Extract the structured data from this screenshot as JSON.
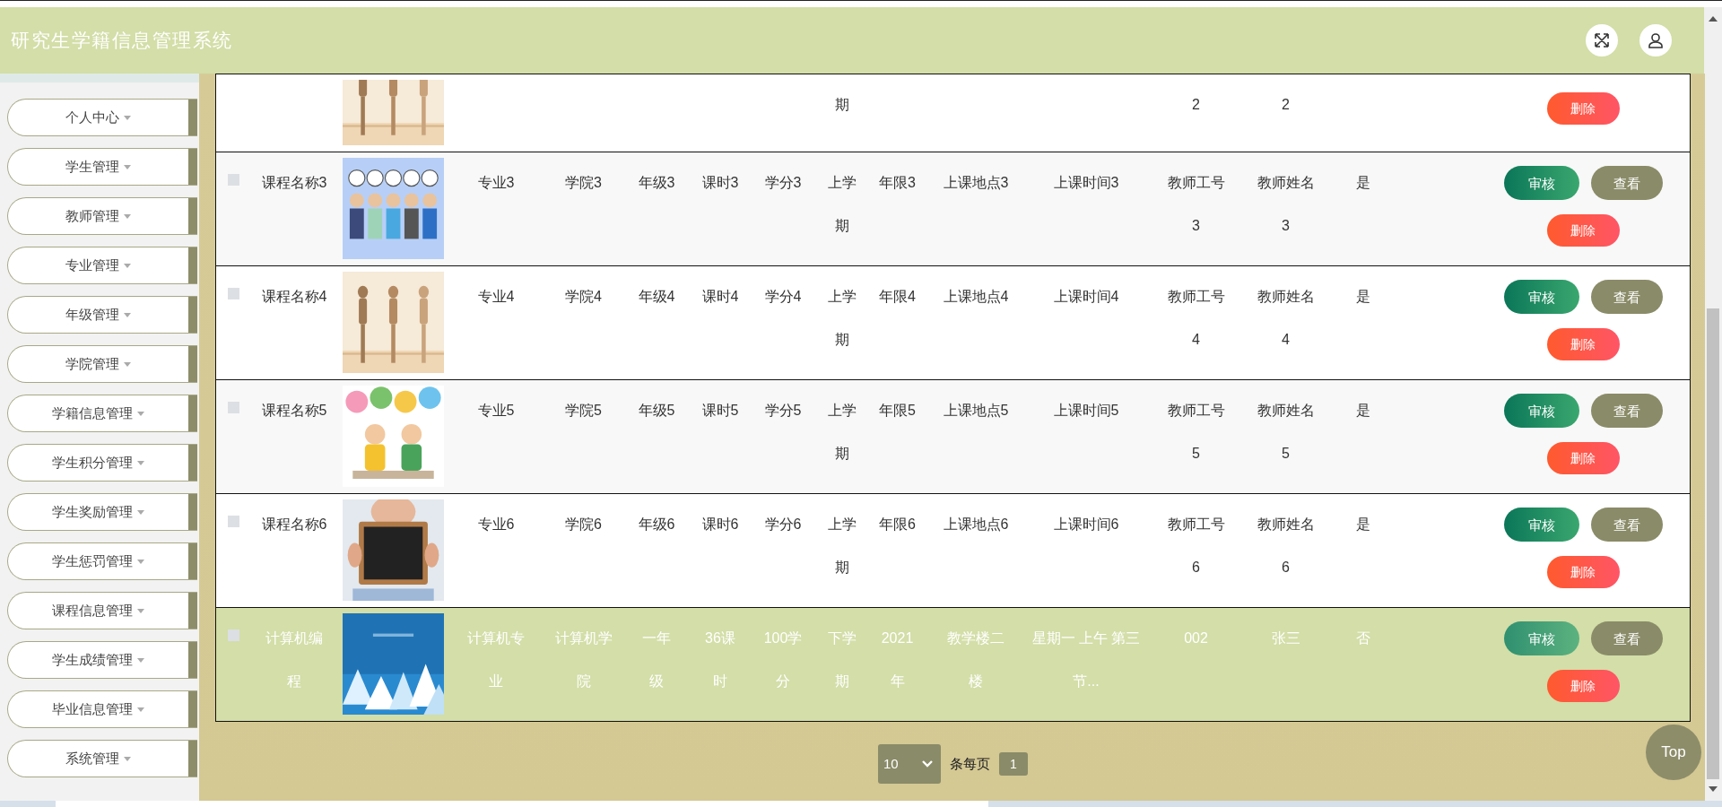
{
  "header": {
    "title": "研究生学籍信息管理系统"
  },
  "sidebar": {
    "items": [
      {
        "label": "个人中心"
      },
      {
        "label": "学生管理"
      },
      {
        "label": "教师管理"
      },
      {
        "label": "专业管理"
      },
      {
        "label": "年级管理"
      },
      {
        "label": "学院管理"
      },
      {
        "label": "学籍信息管理"
      },
      {
        "label": "学生积分管理"
      },
      {
        "label": "学生奖励管理"
      },
      {
        "label": "学生惩罚管理"
      },
      {
        "label": "课程信息管理"
      },
      {
        "label": "学生成绩管理"
      },
      {
        "label": "毕业信息管理"
      },
      {
        "label": "系统管理"
      }
    ]
  },
  "table": {
    "rows": [
      {
        "kind": "partial",
        "selected": false,
        "term": "期",
        "teacher_id": "2",
        "teacher_name": "2",
        "actions": [
          {
            "kind": "delete",
            "label": "删除"
          }
        ]
      },
      {
        "kind": "full",
        "selected": false,
        "checked": false,
        "name": "课程名称3",
        "major": "专业3",
        "college": "学院3",
        "grade": "年级3",
        "hours": "课时3",
        "credits": "学分3",
        "term": "上学期",
        "years": "年限3",
        "location": "上课地点3",
        "time": "上课时间3",
        "teacher_id": "教师工号3",
        "teacher_name": "教师姓名3",
        "approved": "是",
        "actions": [
          {
            "kind": "approve",
            "label": "审核"
          },
          {
            "kind": "view",
            "label": "查看"
          },
          {
            "kind": "delete",
            "label": "删除"
          }
        ]
      },
      {
        "kind": "full",
        "selected": false,
        "checked": false,
        "name": "课程名称4",
        "major": "专业4",
        "college": "学院4",
        "grade": "年级4",
        "hours": "课时4",
        "credits": "学分4",
        "term": "上学期",
        "years": "年限4",
        "location": "上课地点4",
        "time": "上课时间4",
        "teacher_id": "教师工号4",
        "teacher_name": "教师姓名4",
        "approved": "是",
        "actions": [
          {
            "kind": "approve",
            "label": "审核"
          },
          {
            "kind": "view",
            "label": "查看"
          },
          {
            "kind": "delete",
            "label": "删除"
          }
        ]
      },
      {
        "kind": "full",
        "selected": false,
        "checked": false,
        "name": "课程名称5",
        "major": "专业5",
        "college": "学院5",
        "grade": "年级5",
        "hours": "课时5",
        "credits": "学分5",
        "term": "上学期",
        "years": "年限5",
        "location": "上课地点5",
        "time": "上课时间5",
        "teacher_id": "教师工号5",
        "teacher_name": "教师姓名5",
        "approved": "是",
        "actions": [
          {
            "kind": "approve",
            "label": "审核"
          },
          {
            "kind": "view",
            "label": "查看"
          },
          {
            "kind": "delete",
            "label": "删除"
          }
        ]
      },
      {
        "kind": "full",
        "selected": false,
        "checked": false,
        "name": "课程名称6",
        "major": "专业6",
        "college": "学院6",
        "grade": "年级6",
        "hours": "课时6",
        "credits": "学分6",
        "term": "上学期",
        "years": "年限6",
        "location": "上课地点6",
        "time": "上课时间6",
        "teacher_id": "教师工号6",
        "teacher_name": "教师姓名6",
        "approved": "是",
        "actions": [
          {
            "kind": "approve",
            "label": "审核"
          },
          {
            "kind": "view",
            "label": "查看"
          },
          {
            "kind": "delete",
            "label": "删除"
          }
        ]
      },
      {
        "kind": "full",
        "selected": true,
        "checked": false,
        "name": "计算机编程",
        "major": "计算机专业",
        "college": "计算机学院",
        "grade": "一年级",
        "hours": "36课时",
        "credits": "100学分",
        "term": "下学期",
        "years": "2021年",
        "location": "教学楼二楼",
        "time": "星期一 上午 第三节...",
        "teacher_id": "002",
        "teacher_name": "张三",
        "approved": "否",
        "actions": [
          {
            "kind": "approve",
            "label": "审核"
          },
          {
            "kind": "view",
            "label": "查看"
          },
          {
            "kind": "delete",
            "label": "删除"
          }
        ]
      }
    ]
  },
  "pagination": {
    "page_size": "10",
    "per_page_label": "条每页",
    "pages": [
      {
        "label": "1",
        "selected": true
      }
    ]
  },
  "back_to_top": {
    "label": "Top"
  }
}
